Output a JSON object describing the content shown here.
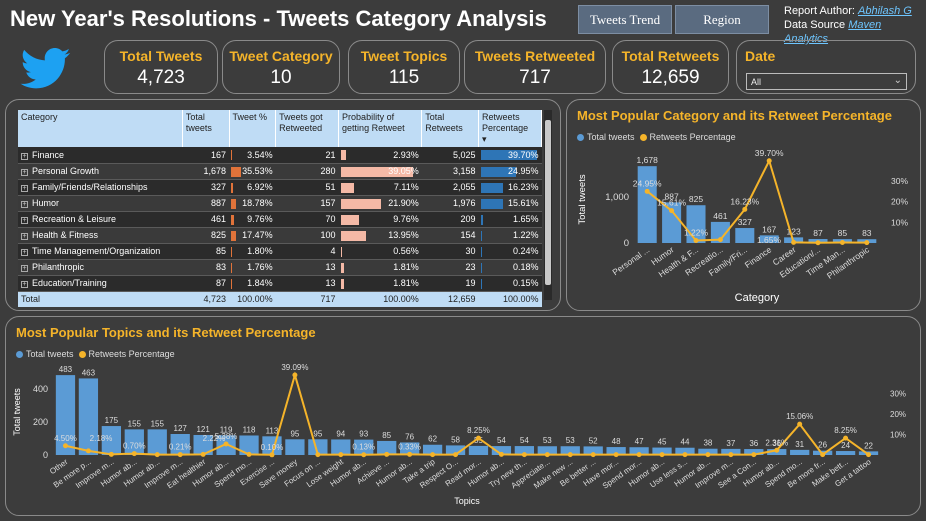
{
  "header": {
    "title": "New Year's Resolutions - Tweets Category Analysis",
    "nav": [
      "Tweets Trend",
      "Region"
    ],
    "author_label": "Report Author:",
    "author_name": "Abhilash G",
    "source_label": "Data Source",
    "source_name": "Maven Analytics"
  },
  "kpis": [
    {
      "label": "Total Tweets",
      "value": "4,723"
    },
    {
      "label": "Tweet Category",
      "value": "10"
    },
    {
      "label": "Tweet Topics",
      "value": "115"
    },
    {
      "label": "Tweets Retweeted",
      "value": "717"
    },
    {
      "label": "Total Retweets",
      "value": "12,659"
    }
  ],
  "date_filter": {
    "label": "Date",
    "value": "All"
  },
  "table": {
    "columns": [
      "Category",
      "Total tweets",
      "Tweet %",
      "Tweets got Retweeted",
      "Probability of getting Retweet",
      "Total Retweets",
      "Retweets Percentage"
    ],
    "rows": [
      {
        "category": "Finance",
        "total": "167",
        "tweet_pct": "3.54%",
        "tweet_pct_v": 3.54,
        "retweeted": "21",
        "prob": "2.93%",
        "prob_v": 2.93,
        "total_rt": "5,025",
        "rt_pct": "39.70%",
        "rt_pct_v": 39.7
      },
      {
        "category": "Personal Growth",
        "total": "1,678",
        "tweet_pct": "35.53%",
        "tweet_pct_v": 35.53,
        "retweeted": "280",
        "prob": "39.05%",
        "prob_v": 39.05,
        "total_rt": "3,158",
        "rt_pct": "24.95%",
        "rt_pct_v": 24.95
      },
      {
        "category": "Family/Friends/Relationships",
        "total": "327",
        "tweet_pct": "6.92%",
        "tweet_pct_v": 6.92,
        "retweeted": "51",
        "prob": "7.11%",
        "prob_v": 7.11,
        "total_rt": "2,055",
        "rt_pct": "16.23%",
        "rt_pct_v": 16.23
      },
      {
        "category": "Humor",
        "total": "887",
        "tweet_pct": "18.78%",
        "tweet_pct_v": 18.78,
        "retweeted": "157",
        "prob": "21.90%",
        "prob_v": 21.9,
        "total_rt": "1,976",
        "rt_pct": "15.61%",
        "rt_pct_v": 15.61
      },
      {
        "category": "Recreation & Leisure",
        "total": "461",
        "tweet_pct": "9.76%",
        "tweet_pct_v": 9.76,
        "retweeted": "70",
        "prob": "9.76%",
        "prob_v": 9.76,
        "total_rt": "209",
        "rt_pct": "1.65%",
        "rt_pct_v": 1.65
      },
      {
        "category": "Health & Fitness",
        "total": "825",
        "tweet_pct": "17.47%",
        "tweet_pct_v": 17.47,
        "retweeted": "100",
        "prob": "13.95%",
        "prob_v": 13.95,
        "total_rt": "154",
        "rt_pct": "1.22%",
        "rt_pct_v": 1.22
      },
      {
        "category": "Time Management/Organization",
        "total": "85",
        "tweet_pct": "1.80%",
        "tweet_pct_v": 1.8,
        "retweeted": "4",
        "prob": "0.56%",
        "prob_v": 0.56,
        "total_rt": "30",
        "rt_pct": "0.24%",
        "rt_pct_v": 0.24
      },
      {
        "category": "Philanthropic",
        "total": "83",
        "tweet_pct": "1.76%",
        "tweet_pct_v": 1.76,
        "retweeted": "13",
        "prob": "1.81%",
        "prob_v": 1.81,
        "total_rt": "23",
        "rt_pct": "0.18%",
        "rt_pct_v": 0.18
      },
      {
        "category": "Education/Training",
        "total": "87",
        "tweet_pct": "1.84%",
        "tweet_pct_v": 1.84,
        "retweeted": "13",
        "prob": "1.81%",
        "prob_v": 1.81,
        "total_rt": "19",
        "rt_pct": "0.15%",
        "rt_pct_v": 0.15
      }
    ],
    "total": {
      "label": "Total",
      "total": "4,723",
      "tweet_pct": "100.00%",
      "retweeted": "717",
      "prob": "100.00%",
      "total_rt": "12,659",
      "rt_pct": "100.00%"
    }
  },
  "colors": {
    "bar": "#5b9bd5",
    "line": "#f5b42a",
    "accent": "#f5b42a",
    "tweetpct_bar": "#e0733a",
    "prob_bar": "#f4b9a6",
    "rt_bar": "#2e75b6"
  },
  "chart_data": [
    {
      "type": "bar",
      "title": "Most Popular Category and its Retweet Percentage",
      "xlabel": "Category",
      "ylabel": "Total tweets",
      "legend": [
        "Total tweets",
        "Retweets Percentage"
      ],
      "categories": [
        "Personal ...",
        "Humor",
        "Health & F...",
        "Recreatio...",
        "Family/Fri...",
        "Finance",
        "Career",
        "Education/...",
        "Time Man...",
        "Philanthropic"
      ],
      "series": [
        {
          "name": "Total tweets",
          "values": [
            1678,
            887,
            825,
            461,
            327,
            167,
            123,
            87,
            85,
            83
          ]
        },
        {
          "name": "Retweets Percentage",
          "values": [
            24.95,
            15.61,
            1.22,
            1.65,
            16.23,
            39.7,
            0.3,
            0.15,
            0.24,
            0.18
          ]
        }
      ],
      "bar_labels": [
        "1,678",
        "887",
        "825",
        "461",
        "327",
        "167",
        "123",
        "87",
        "85",
        "83"
      ],
      "line_labels": [
        "24.95%",
        "15.61%",
        "1.22%",
        "",
        "16.23%",
        "39.70%",
        "",
        "",
        "",
        ""
      ],
      "extra_labels": [
        "1.65%"
      ],
      "y_ticks": [
        "0",
        "1,000"
      ],
      "y2_ticks": [
        "10%",
        "20%",
        "30%"
      ],
      "ylim": [
        0,
        1900
      ],
      "y2lim": [
        0,
        42
      ]
    },
    {
      "type": "bar",
      "title": "Most Popular Topics and its Retweet Percentage",
      "xlabel": "Topics",
      "ylabel": "Total tweets",
      "legend": [
        "Total tweets",
        "Retweets Percentage"
      ],
      "categories": [
        "Other",
        "Be more p...",
        "Improve m...",
        "Humor ab...",
        "Humor ab...",
        "Improve m...",
        "Eat healthier",
        "Humor ab...",
        "Spend mo...",
        "Exercise ...",
        "Save money",
        "Focus on ...",
        "Lose weight",
        "Humor ab...",
        "Achieve ...",
        "Humor ab...",
        "Take a trip",
        "Respect O...",
        "Read mor...",
        "Humor ab...",
        "Try new th...",
        "Appreciate...",
        "Make new ...",
        "Be better ...",
        "Have mor...",
        "Spend mor...",
        "Humor ab...",
        "Use less s...",
        "Humor ab...",
        "Improve m...",
        "See a Con...",
        "Humor ab...",
        "Spend mo...",
        "Be more fr...",
        "Make bett...",
        "Get a tattoo"
      ],
      "series": [
        {
          "name": "Total tweets",
          "values": [
            483,
            463,
            175,
            155,
            155,
            127,
            121,
            119,
            118,
            113,
            95,
            95,
            94,
            93,
            85,
            76,
            62,
            58,
            55,
            54,
            54,
            53,
            53,
            52,
            48,
            47,
            45,
            44,
            38,
            37,
            36,
            36,
            31,
            26,
            24,
            22
          ]
        },
        {
          "name": "Retweets Percentage",
          "values": [
            4.5,
            2.0,
            0.3,
            0.7,
            0.2,
            0.21,
            0.3,
            5.38,
            0.3,
            0.1,
            39.09,
            0.2,
            0.2,
            0.13,
            0.3,
            0.33,
            0.2,
            0.2,
            8.25,
            0.3,
            0.2,
            0.2,
            0.2,
            0.2,
            0.2,
            0.2,
            0.2,
            0.2,
            0.2,
            0.2,
            0.2,
            2.31,
            15.06,
            0.2,
            8.25,
            0.2
          ]
        }
      ],
      "line_labels": {
        "0": "4.50%",
        "3": "0.70%",
        "5": "0.21%",
        "7": "5.38%",
        "9": "0.10%",
        "10": "39.09%",
        "13": "0.13%",
        "15": "0.33%",
        "18": "8.25%",
        "31": "2.31%",
        "32": "15.06%",
        "34": "8.25%"
      },
      "extra_labels": [
        "2.18%",
        "2.22%"
      ],
      "y_ticks": [
        "0",
        "200",
        "400"
      ],
      "y2_ticks": [
        "10%",
        "20%",
        "30%"
      ],
      "ylim": [
        0,
        520
      ],
      "y2lim": [
        0,
        42
      ]
    }
  ]
}
